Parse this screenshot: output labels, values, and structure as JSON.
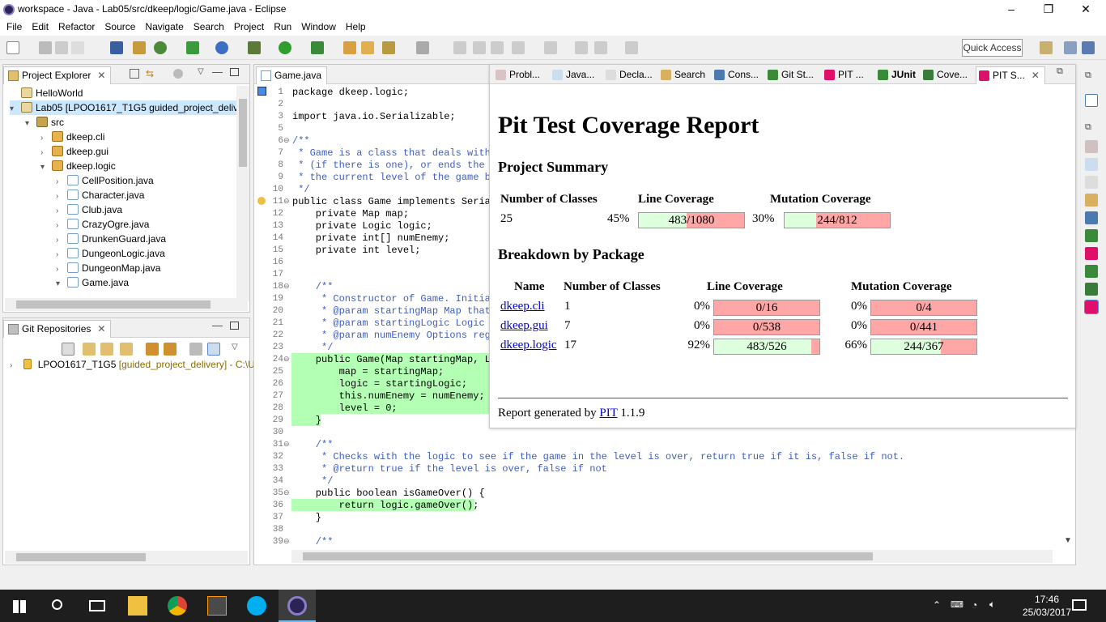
{
  "window": {
    "title": "workspace - Java - Lab05/src/dkeep/logic/Game.java - Eclipse"
  },
  "menu": [
    "File",
    "Edit",
    "Refactor",
    "Source",
    "Navigate",
    "Search",
    "Project",
    "Run",
    "Window",
    "Help"
  ],
  "quick_access": "Quick Access",
  "explorer": {
    "tab": "Project Explorer",
    "items": [
      {
        "label": "HelloWorld",
        "indent": 0,
        "arrow": "",
        "icon": "proj"
      },
      {
        "label": "Lab05 [LPOO1617_T1G5 guided_project_delive",
        "indent": 0,
        "arrow": "▾",
        "icon": "proj"
      },
      {
        "label": "src",
        "indent": 1,
        "arrow": "▾",
        "icon": "src"
      },
      {
        "label": "dkeep.cli",
        "indent": 2,
        "arrow": "›",
        "icon": "pkg"
      },
      {
        "label": "dkeep.gui",
        "indent": 2,
        "arrow": "›",
        "icon": "pkg"
      },
      {
        "label": "dkeep.logic",
        "indent": 2,
        "arrow": "▾",
        "icon": "pkg"
      },
      {
        "label": "CellPosition.java",
        "indent": 3,
        "arrow": "›",
        "icon": "java"
      },
      {
        "label": "Character.java",
        "indent": 3,
        "arrow": "›",
        "icon": "java"
      },
      {
        "label": "Club.java",
        "indent": 3,
        "arrow": "›",
        "icon": "java"
      },
      {
        "label": "CrazyOgre.java",
        "indent": 3,
        "arrow": "›",
        "icon": "java"
      },
      {
        "label": "DrunkenGuard.java",
        "indent": 3,
        "arrow": "›",
        "icon": "java"
      },
      {
        "label": "DungeonLogic.java",
        "indent": 3,
        "arrow": "›",
        "icon": "java"
      },
      {
        "label": "DungeonMap.java",
        "indent": 3,
        "arrow": "›",
        "icon": "java"
      },
      {
        "label": "Game.java",
        "indent": 3,
        "arrow": "▾",
        "icon": "java"
      }
    ]
  },
  "git": {
    "tab": "Git Repositories",
    "repo": "LPOO1617_T1G5",
    "branch": "[guided_project_delivery] - C:\\U"
  },
  "editor": {
    "tab": "Game.java",
    "lines": [
      {
        "n": "1",
        "t": "package dkeep.logic;"
      },
      {
        "n": "2",
        "t": ""
      },
      {
        "n": "3",
        "t": "import java.io.Serializable;"
      },
      {
        "n": "5",
        "t": ""
      },
      {
        "n": "6",
        "t": "/**"
      },
      {
        "n": "7",
        "t": " * Game is a class that deals with"
      },
      {
        "n": "8",
        "t": " * (if there is one), or ends the"
      },
      {
        "n": "9",
        "t": " * the current level of the game b"
      },
      {
        "n": "10",
        "t": " */"
      },
      {
        "n": "11",
        "t": "public class Game implements Seria"
      },
      {
        "n": "12",
        "t": "    private Map map;"
      },
      {
        "n": "13",
        "t": "    private Logic logic;"
      },
      {
        "n": "14",
        "t": "    private int[] numEnemy;"
      },
      {
        "n": "15",
        "t": "    private int level;"
      },
      {
        "n": "16",
        "t": ""
      },
      {
        "n": "17",
        "t": ""
      },
      {
        "n": "18",
        "t": "    /**"
      },
      {
        "n": "19",
        "t": "     * Constructor of Game. Initia"
      },
      {
        "n": "20",
        "t": "     * @param startingMap Map that"
      },
      {
        "n": "21",
        "t": "     * @param startingLogic Logic"
      },
      {
        "n": "22",
        "t": "     * @param numEnemy Options reg"
      },
      {
        "n": "23",
        "t": "     */"
      },
      {
        "n": "24",
        "t": "    public Game(Map startingMap, Lo"
      },
      {
        "n": "25",
        "t": "        map = startingMap;"
      },
      {
        "n": "26",
        "t": "        logic = startingLogic;"
      },
      {
        "n": "27",
        "t": "        this.numEnemy = numEnemy;"
      },
      {
        "n": "28",
        "t": "        level = 0;"
      },
      {
        "n": "29",
        "t": "    }"
      },
      {
        "n": "30",
        "t": ""
      },
      {
        "n": "31",
        "t": "    /**"
      },
      {
        "n": "32",
        "t": "     * Checks with the logic to see if the game in the level is over, return true if it is, false if not."
      },
      {
        "n": "33",
        "t": "     * @return true if the level is over, false if not"
      },
      {
        "n": "34",
        "t": "     */"
      },
      {
        "n": "35",
        "t": "    public boolean isGameOver() {"
      },
      {
        "n": "36",
        "t": "        return logic.gameOver();"
      },
      {
        "n": "37",
        "t": "    }"
      },
      {
        "n": "38",
        "t": ""
      },
      {
        "n": "39",
        "t": "    /**"
      }
    ]
  },
  "views": [
    "Probl...",
    "Java...",
    "Decla...",
    "Search",
    "Cons...",
    "Git St...",
    "PIT ...",
    "JUnit",
    "Cove...",
    "PIT S..."
  ],
  "report": {
    "title": "Pit Test Coverage Report",
    "summary_heading": "Project Summary",
    "summary_headers": [
      "Number of Classes",
      "Line Coverage",
      "Mutation Coverage"
    ],
    "summary": {
      "classes": "25",
      "line_pct": "45%",
      "line_text": "483/1080",
      "line_fill": 0.45,
      "mut_pct": "30%",
      "mut_text": "244/812",
      "mut_fill": 0.3
    },
    "breakdown_heading": "Breakdown by Package",
    "breakdown_headers": [
      "Name",
      "Number of Classes",
      "Line Coverage",
      "Mutation Coverage"
    ],
    "packages": [
      {
        "name": "dkeep.cli",
        "classes": "1",
        "line_pct": "0%",
        "line_text": "0/16",
        "line_fill": 0,
        "mut_pct": "0%",
        "mut_text": "0/4",
        "mut_fill": 0
      },
      {
        "name": "dkeep.gui",
        "classes": "7",
        "line_pct": "0%",
        "line_text": "0/538",
        "line_fill": 0,
        "mut_pct": "0%",
        "mut_text": "0/441",
        "mut_fill": 0
      },
      {
        "name": "dkeep.logic",
        "classes": "17",
        "line_pct": "92%",
        "line_text": "483/526",
        "line_fill": 0.92,
        "mut_pct": "66%",
        "mut_text": "244/367",
        "mut_fill": 0.66
      }
    ],
    "footer_prefix": "Report generated by ",
    "footer_link": "PIT",
    "footer_suffix": " 1.1.9"
  },
  "clock": {
    "time": "17:46",
    "date": "25/03/2017"
  },
  "colors": {
    "covered": "#ddffdd",
    "uncovered": "#ffa6a6",
    "code_green": "#b3ffb3"
  }
}
